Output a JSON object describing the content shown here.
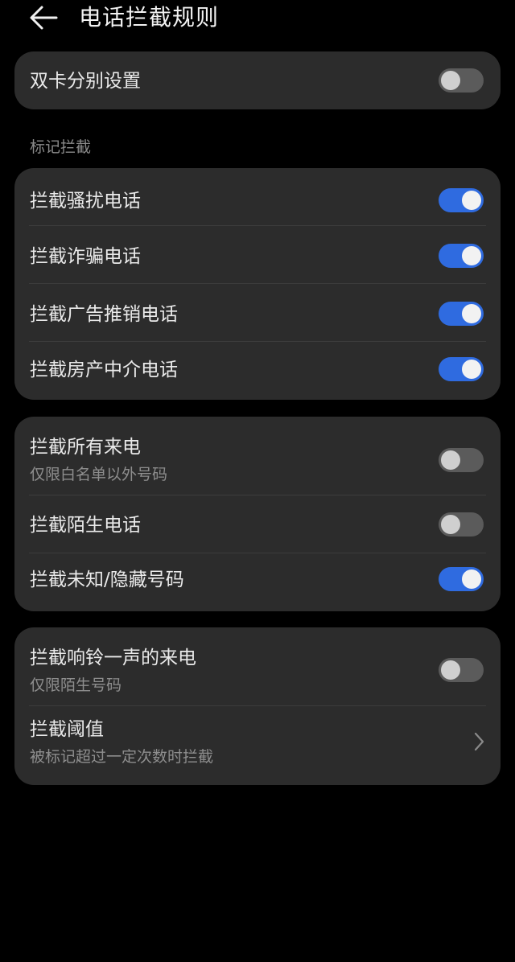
{
  "header": {
    "title": "电话拦截规则"
  },
  "dual_sim": {
    "label": "双卡分别设置",
    "enabled": false
  },
  "marked_section": {
    "label": "标记拦截",
    "items": [
      {
        "label": "拦截骚扰电话",
        "enabled": true
      },
      {
        "label": "拦截诈骗电话",
        "enabled": true
      },
      {
        "label": "拦截广告推销电话",
        "enabled": true
      },
      {
        "label": "拦截房产中介电话",
        "enabled": true
      }
    ]
  },
  "call_section": {
    "items": [
      {
        "label": "拦截所有来电",
        "sublabel": "仅限白名单以外号码",
        "enabled": false
      },
      {
        "label": "拦截陌生电话",
        "enabled": false
      },
      {
        "label": "拦截未知/隐藏号码",
        "enabled": true
      }
    ]
  },
  "ring_section": {
    "ring_once": {
      "label": "拦截响铃一声的来电",
      "sublabel": "仅限陌生号码",
      "enabled": false
    },
    "threshold": {
      "label": "拦截阈值",
      "sublabel": "被标记超过一定次数时拦截"
    }
  },
  "colors": {
    "background": "#000000",
    "card": "#2c2c2c",
    "toggle_on": "#2f6be0",
    "toggle_off": "#5b5b5b"
  }
}
